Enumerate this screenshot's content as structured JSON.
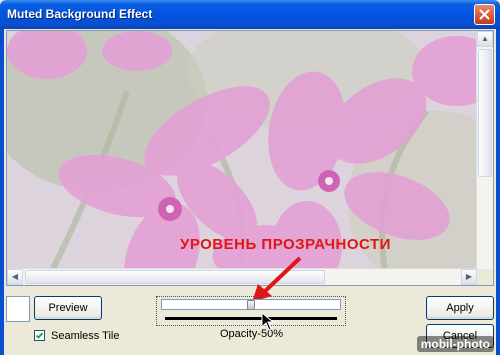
{
  "window": {
    "title": "Muted Background Effect"
  },
  "annotation": {
    "text": "УРОВЕНЬ ПРОЗРАЧНОСТИ",
    "color": "#e01515"
  },
  "controls": {
    "preview_label": "Preview",
    "apply_label": "Apply",
    "cancel_label": "Cancel",
    "seamless_label": "Seamless Tile",
    "seamless_checked": true,
    "opacity_label": "Opacity-50%",
    "opacity_value": 0.5
  },
  "watermark": {
    "text": "mobil-photo"
  },
  "colors": {
    "titlebar": "#0054e3",
    "flower": "#e08ccf",
    "background": "#ece9d8"
  },
  "icons": {
    "close": "close-icon",
    "checkmark": "checkmark-icon"
  }
}
